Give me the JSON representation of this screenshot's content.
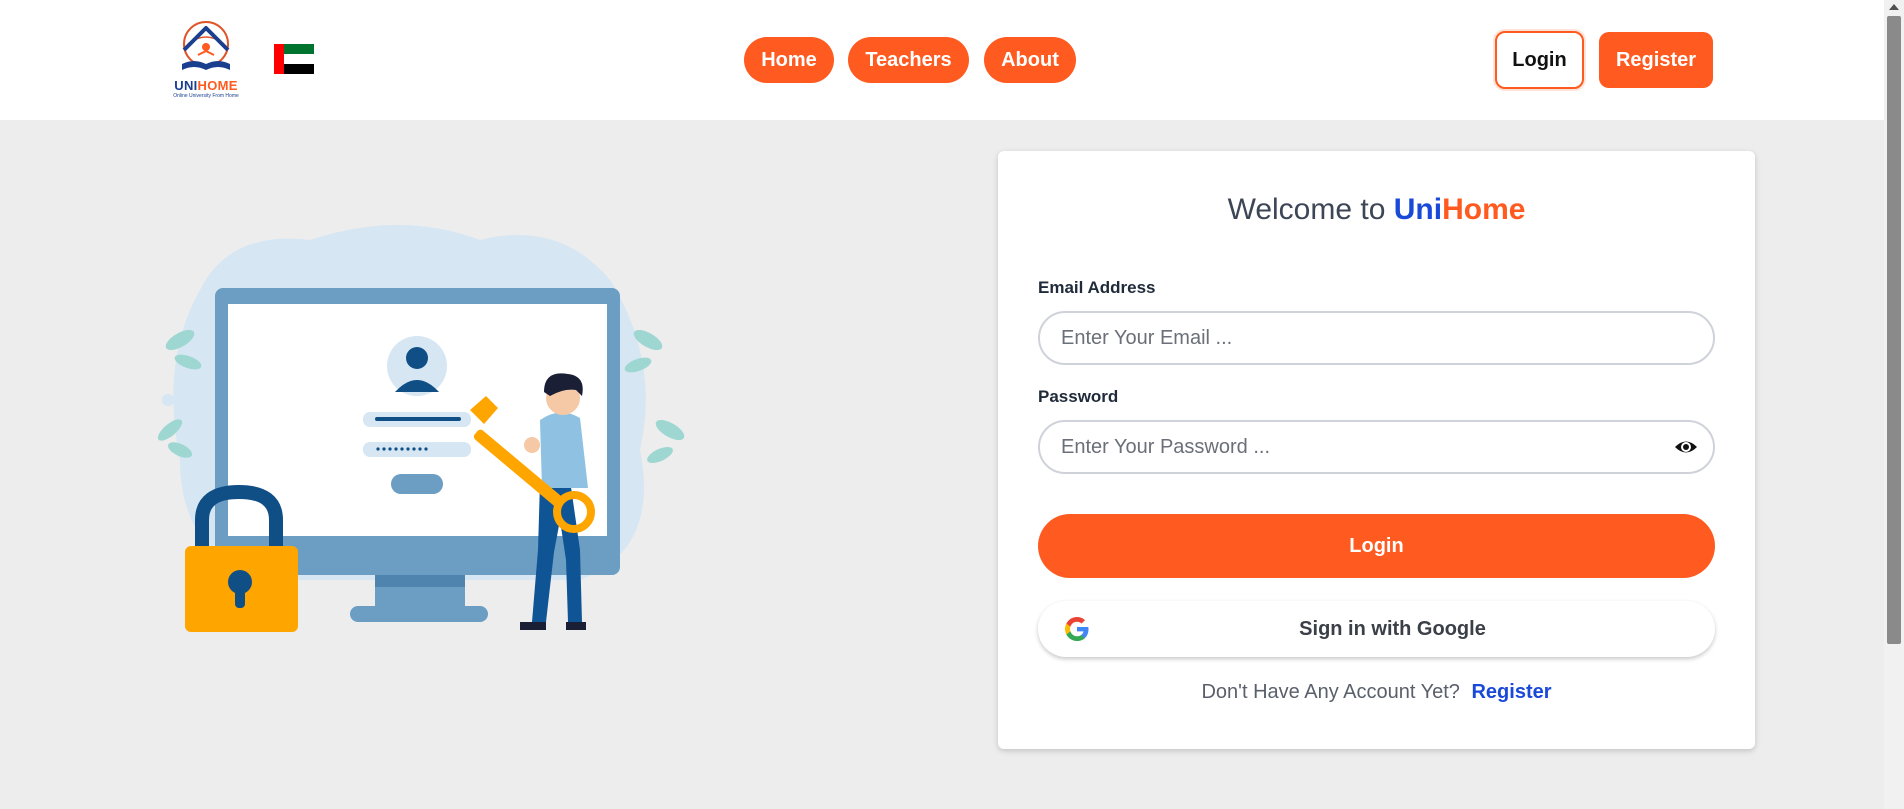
{
  "header": {
    "logo": {
      "brand_part1": "UNI",
      "brand_part2": "HOME",
      "tagline": "Online University From Home"
    },
    "flag_icon": "uae-flag-icon",
    "nav": [
      {
        "label": "Home"
      },
      {
        "label": "Teachers"
      },
      {
        "label": "About"
      }
    ],
    "login_label": "Login",
    "register_label": "Register"
  },
  "login_card": {
    "welcome_prefix": "Welcome to",
    "brand_part1": "Uni",
    "brand_part2": "Home",
    "email_label": "Email Address",
    "email_placeholder": "Enter Your Email ...",
    "password_label": "Password",
    "password_placeholder": "Enter Your Password ...",
    "submit_label": "Login",
    "google_label": "Sign in with Google",
    "no_account_text": "Don't Have Any Account Yet?",
    "register_link": "Register"
  },
  "colors": {
    "accent": "#ff5a1f",
    "brand_blue": "#1849d8",
    "page_background": "#ededed"
  },
  "icons": [
    "uni-home-logo",
    "uae-flag-icon",
    "eye-icon",
    "google-icon",
    "padlock-icon",
    "key-icon"
  ]
}
